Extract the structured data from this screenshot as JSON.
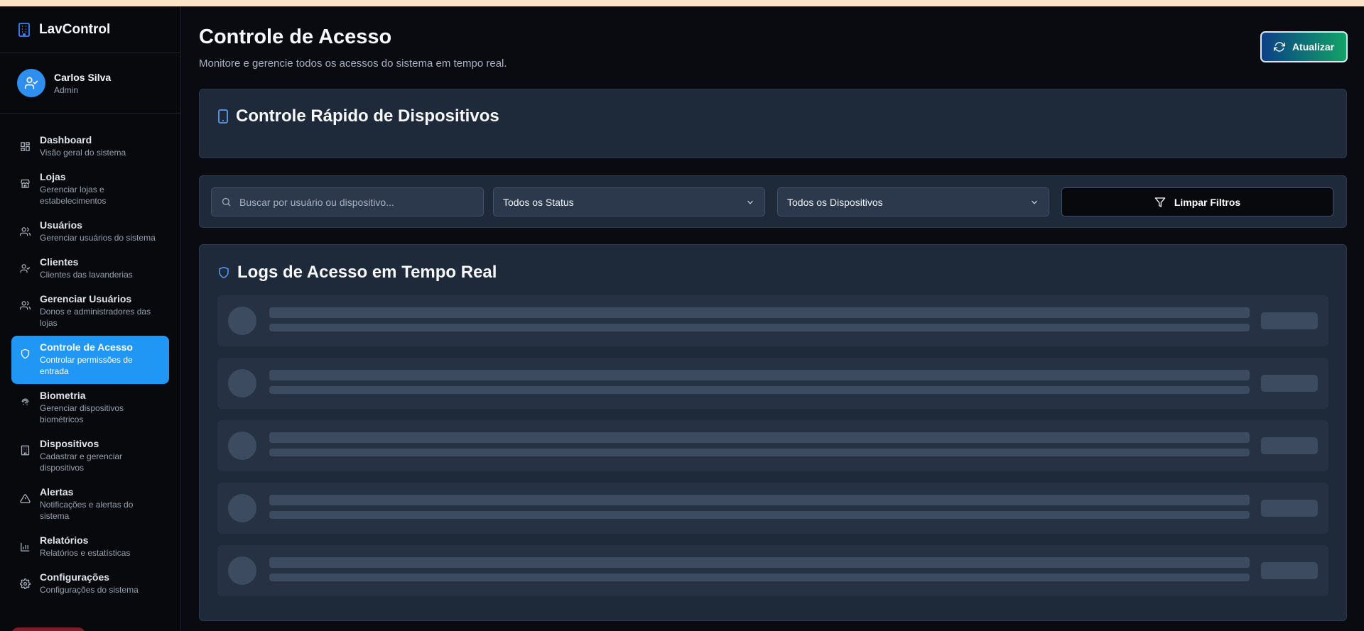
{
  "app": {
    "name": "LavControl",
    "icon": "building-icon",
    "accent": "#2197f5"
  },
  "user": {
    "name": "Carlos Silva",
    "role": "Admin",
    "avatar_icon": "user-check-icon"
  },
  "sidebar": {
    "active_index": 5,
    "items": [
      {
        "label": "Dashboard",
        "desc": "Visão geral do sistema",
        "icon": "layout-grid-icon"
      },
      {
        "label": "Lojas",
        "desc": "Gerenciar lojas e estabelecimentos",
        "icon": "store-icon"
      },
      {
        "label": "Usuários",
        "desc": "Gerenciar usuários do sistema",
        "icon": "users-icon"
      },
      {
        "label": "Clientes",
        "desc": "Clientes das lavanderias",
        "icon": "user-check-icon"
      },
      {
        "label": "Gerenciar Usuários",
        "desc": "Donos e administradores das lojas",
        "icon": "users-icon"
      },
      {
        "label": "Controle de Acesso",
        "desc": "Controlar permissões de entrada",
        "icon": "shield-icon"
      },
      {
        "label": "Biometria",
        "desc": "Gerenciar dispositivos biométricos",
        "icon": "fingerprint-icon"
      },
      {
        "label": "Dispositivos",
        "desc": "Cadastrar e gerenciar dispositivos",
        "icon": "building-icon"
      },
      {
        "label": "Alertas",
        "desc": "Notificações e alertas do sistema",
        "icon": "alert-triangle-icon"
      },
      {
        "label": "Relatórios",
        "desc": "Relatórios e estatísticas",
        "icon": "bar-chart-icon"
      },
      {
        "label": "Configurações",
        "desc": "Configurações do sistema",
        "icon": "gear-icon"
      }
    ]
  },
  "header": {
    "title": "Controle de Acesso",
    "subtitle": "Monitore e gerencie todos os acessos do sistema em tempo real.",
    "refresh_label": "Atualizar"
  },
  "quick_control": {
    "title": "Controle Rápido de Dispositivos",
    "icon": "tablet-icon"
  },
  "filters": {
    "search_placeholder": "Buscar por usuário ou dispositivo...",
    "status_selected": "Todos os Status",
    "device_selected": "Todos os Dispositivos",
    "clear_label": "Limpar Filtros"
  },
  "logs": {
    "title": "Logs de Acesso em Tempo Real",
    "icon": "shield-icon",
    "loading_rows": 5
  }
}
